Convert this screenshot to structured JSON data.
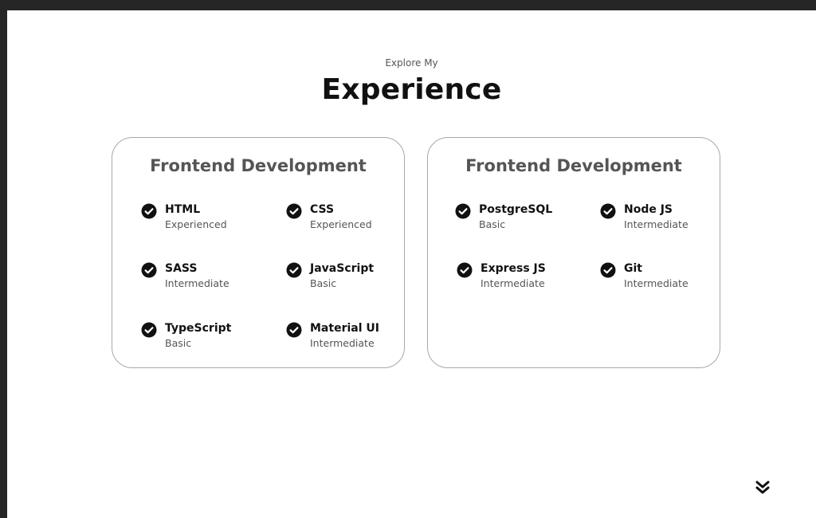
{
  "header": {
    "subtitle": "Explore My",
    "title": "Experience"
  },
  "cards": [
    {
      "title": "Frontend Development",
      "skills": [
        {
          "name": "HTML",
          "level": "Experienced"
        },
        {
          "name": "CSS",
          "level": "Experienced"
        },
        {
          "name": "SASS",
          "level": "Intermediate"
        },
        {
          "name": "JavaScript",
          "level": "Basic"
        },
        {
          "name": "TypeScript",
          "level": "Basic"
        },
        {
          "name": "Material UI",
          "level": "Intermediate"
        }
      ]
    },
    {
      "title": "Frontend Development",
      "skills": [
        {
          "name": "PostgreSQL",
          "level": "Basic"
        },
        {
          "name": "Node JS",
          "level": "Intermediate"
        },
        {
          "name": "Express JS",
          "level": "Intermediate"
        },
        {
          "name": "Git",
          "level": "Intermediate"
        }
      ]
    }
  ],
  "icons": {
    "skill": "check-badge-icon",
    "scroll": "double-chevron-down-icon"
  },
  "colors": {
    "outer_border": "#262626",
    "card_border": "#a8a8a8",
    "heading_text": "#111111",
    "muted_text": "#555555"
  }
}
